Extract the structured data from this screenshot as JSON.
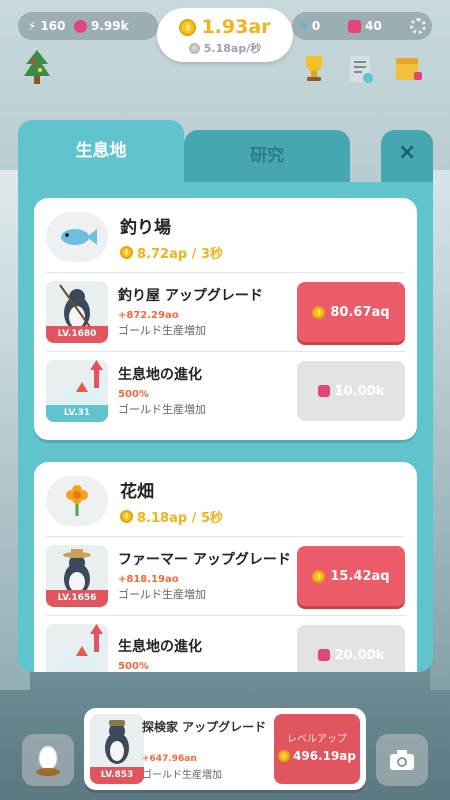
{
  "top": {
    "energy": "160",
    "hearts": "9.99k",
    "gold_total": "1.93ar",
    "gold_rate": "5.18ap/秒",
    "bolts": "0",
    "gems": "40"
  },
  "panel": {
    "tab_active": "生息地",
    "tab_inactive": "研究",
    "close": "×"
  },
  "cards": [
    {
      "title": "釣り場",
      "rate": "8.72ap / 3秒",
      "rows": [
        {
          "level": "LV.1680",
          "title": "釣り屋 アップグレード",
          "bonus": "+872.29ao",
          "desc": "ゴールド生産増加",
          "price": "80.67aq"
        },
        {
          "level": "LV.31",
          "title": "生息地の進化",
          "bonus": "500%",
          "desc": "ゴールド生産増加",
          "price": "10.00k"
        }
      ]
    },
    {
      "title": "花畑",
      "rate": "8.18ap / 5秒",
      "rows": [
        {
          "level": "LV.1656",
          "title": "ファーマー アップグレード",
          "bonus": "+818.19ao",
          "desc": "ゴールド生産増加",
          "price": "15.42aq"
        },
        {
          "level": "",
          "title": "生息地の進化",
          "bonus": "500%",
          "desc": "",
          "price": "20.00k"
        }
      ]
    }
  ],
  "bottom": {
    "level": "LV.853",
    "title": "探検家 アップグレード",
    "bonus": "+647.96an",
    "desc": "ゴールド生産増加",
    "btn_label": "レベルアップ",
    "btn_price": "496.19ap"
  },
  "colors": {
    "accent": "#5fc4ce",
    "buy": "#ec5b68",
    "gold": "#f0b31c",
    "bonus": "#f06a3a"
  }
}
